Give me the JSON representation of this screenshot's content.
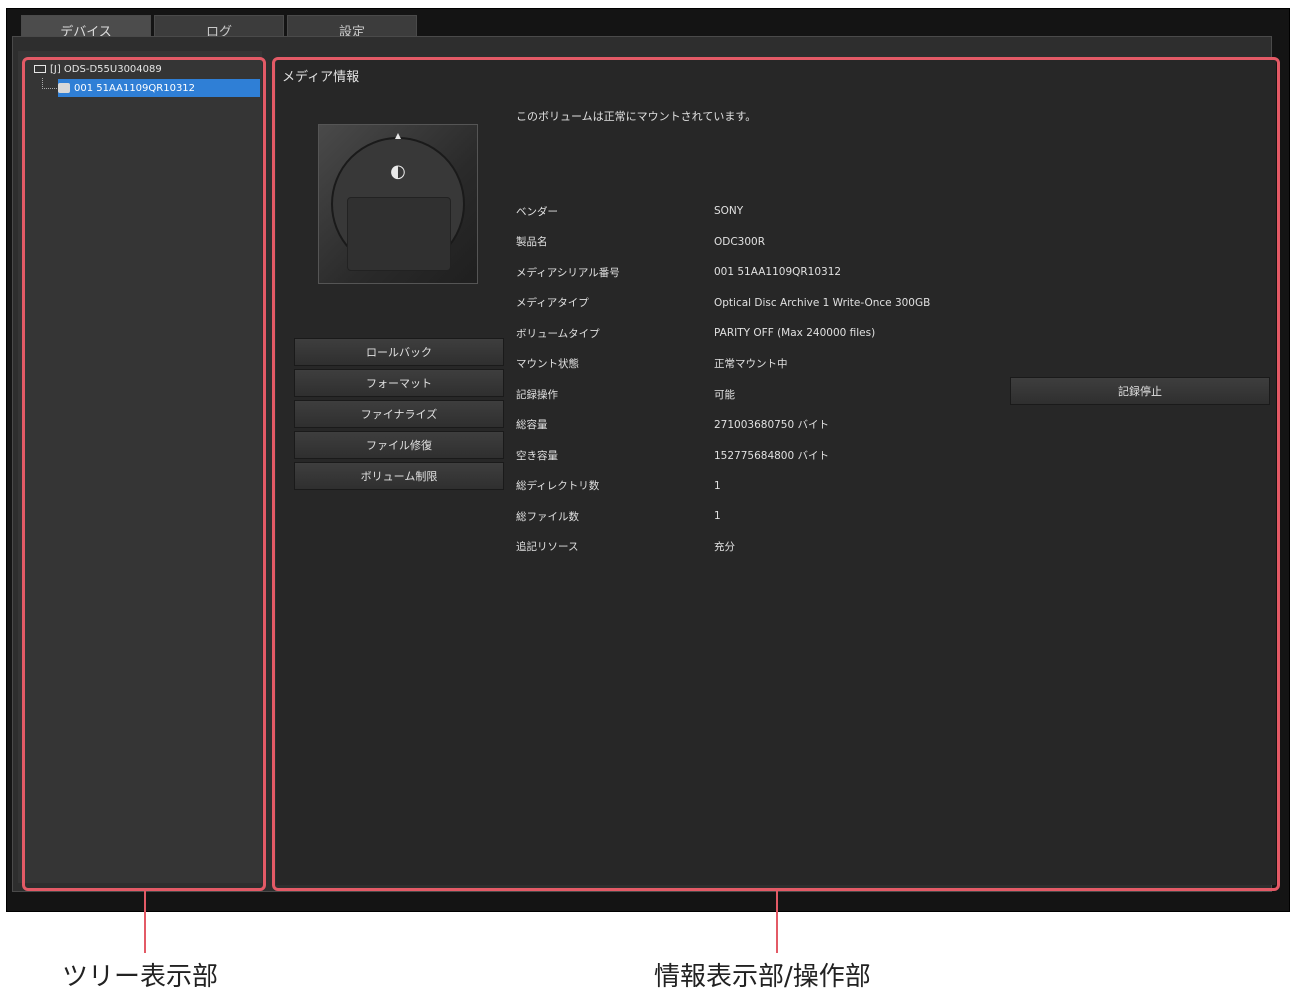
{
  "tabs": [
    {
      "label": "デバイス",
      "active": true
    },
    {
      "label": "ログ",
      "active": false
    },
    {
      "label": "設定",
      "active": false
    }
  ],
  "tree": {
    "root_label": "[J] ODS-D55U3004089",
    "child_label": "001 51AA1109QR10312"
  },
  "info": {
    "section_title": "メディア情報",
    "mount_message": "このボリュームは正常にマウントされています。",
    "properties": [
      {
        "label": "ベンダー",
        "value": "SONY"
      },
      {
        "label": "製品名",
        "value": "ODC300R"
      },
      {
        "label": "メディアシリアル番号",
        "value": "001 51AA1109QR10312"
      },
      {
        "label": "メディアタイプ",
        "value": "Optical Disc Archive 1 Write-Once 300GB"
      },
      {
        "label": "ボリュームタイプ",
        "value": "PARITY OFF (Max 240000 files)"
      },
      {
        "label": "マウント状態",
        "value": "正常マウント中"
      },
      {
        "label": "記録操作",
        "value": "可能"
      },
      {
        "label": "総容量",
        "value": "271003680750 バイト"
      },
      {
        "label": "空き容量",
        "value": "152775684800 バイト"
      },
      {
        "label": "総ディレクトリ数",
        "value": "1"
      },
      {
        "label": "総ファイル数",
        "value": "1"
      },
      {
        "label": "追記リソース",
        "value": "充分"
      }
    ],
    "buttons": [
      "ロールバック",
      "フォーマット",
      "ファイナライズ",
      "ファイル修復",
      "ボリューム制限"
    ],
    "record_stop_label": "記録停止"
  },
  "annotations": {
    "tree_label": "ツリー表示部",
    "info_label": "情報表示部/操作部"
  },
  "colors": {
    "highlight": "#e35a66",
    "selection": "#2f7fd6",
    "panel": "#272727"
  }
}
